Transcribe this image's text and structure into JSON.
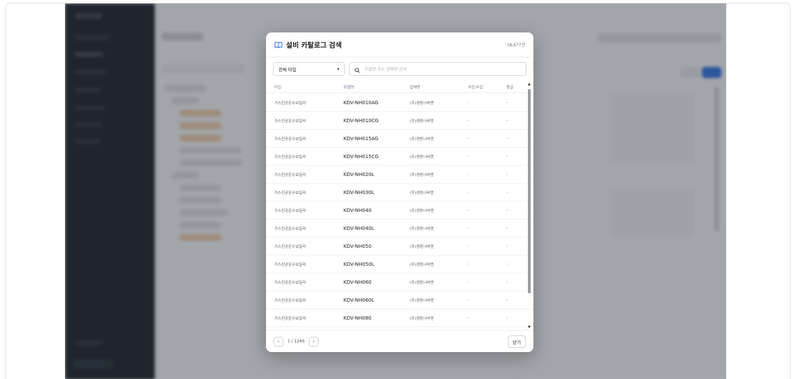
{
  "modal": {
    "title": "설비 카탈로그 검색",
    "icon": "book-open-icon",
    "total_count": "18,677건",
    "type_select": "전체 타입",
    "search_placeholder": "모델명 또는 업체명 검색",
    "columns": [
      "타입",
      "모델명",
      "업체명",
      "국산/수입",
      "등급"
    ],
    "rows": [
      {
        "type": "가스진공온수보일러",
        "model": "KDV-NH010AG",
        "company": "(주)경동나비엔",
        "origin": "-",
        "grade": "-"
      },
      {
        "type": "가스진공온수보일러",
        "model": "KDV-NH010CG",
        "company": "(주)경동나비엔",
        "origin": "-",
        "grade": "-"
      },
      {
        "type": "가스진공온수보일러",
        "model": "KDV-NH015AG",
        "company": "(주)경동나비엔",
        "origin": "-",
        "grade": "-"
      },
      {
        "type": "가스진공온수보일러",
        "model": "KDV-NH015CG",
        "company": "(주)경동나비엔",
        "origin": "-",
        "grade": "-"
      },
      {
        "type": "가스진공온수보일러",
        "model": "KDV-NH020L",
        "company": "(주)경동나비엔",
        "origin": "-",
        "grade": "-"
      },
      {
        "type": "가스진공온수보일러",
        "model": "KDV-NH030L",
        "company": "(주)경동나비엔",
        "origin": "-",
        "grade": "-"
      },
      {
        "type": "가스진공온수보일러",
        "model": "KDV-NH040",
        "company": "(주)경동나비엔",
        "origin": "-",
        "grade": "-"
      },
      {
        "type": "가스진공온수보일러",
        "model": "KDV-NH040L",
        "company": "(주)경동나비엔",
        "origin": "-",
        "grade": "-"
      },
      {
        "type": "가스진공온수보일러",
        "model": "KDV-NH050",
        "company": "(주)경동나비엔",
        "origin": "-",
        "grade": "-"
      },
      {
        "type": "가스진공온수보일러",
        "model": "KDV-NH050L",
        "company": "(주)경동나비엔",
        "origin": "-",
        "grade": "-"
      },
      {
        "type": "가스진공온수보일러",
        "model": "KDV-NH060",
        "company": "(주)경동나비엔",
        "origin": "-",
        "grade": "-"
      },
      {
        "type": "가스진공온수보일러",
        "model": "KDV-NH060L",
        "company": "(주)경동나비엔",
        "origin": "-",
        "grade": "-"
      },
      {
        "type": "가스진공온수보일러",
        "model": "KDV-NH080",
        "company": "(주)경동나비엔",
        "origin": "-",
        "grade": "-"
      }
    ],
    "pagination": {
      "prev": "‹",
      "next": "›",
      "text": "1 / 1246"
    },
    "close_label": "닫기"
  },
  "colors": {
    "accent": "#2f6fde",
    "sidebar": "#1b2129",
    "overlay": "rgba(40,44,52,0.38)"
  }
}
